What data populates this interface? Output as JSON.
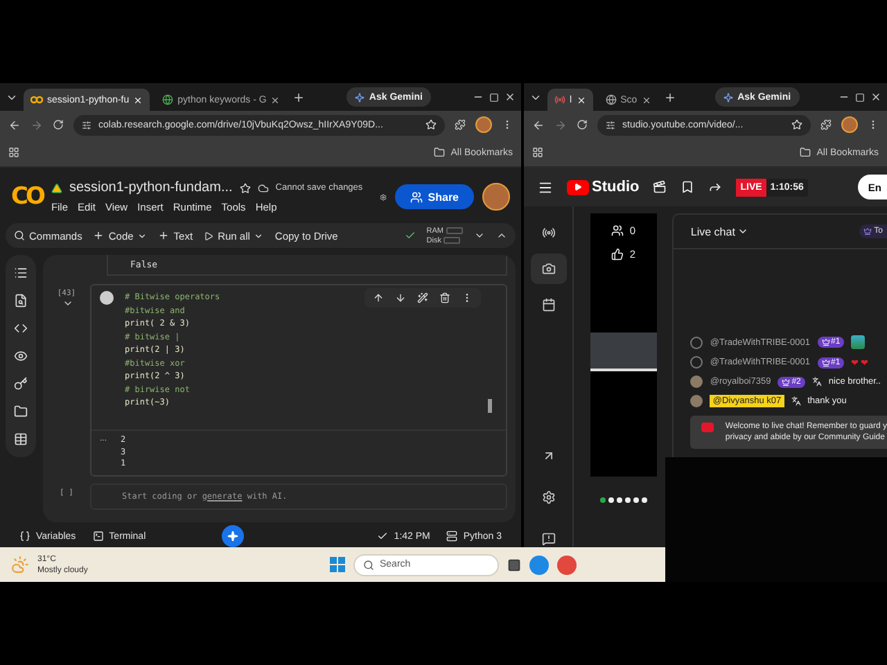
{
  "colab_window": {
    "tabs": [
      {
        "title": "session1-python-fu",
        "selected": true,
        "kind": "colab"
      },
      {
        "title": "python keywords - G",
        "selected": false,
        "kind": "google"
      }
    ],
    "ask_gemini": "Ask Gemini",
    "url": "colab.research.google.com/drive/10jVbuKq2Owsz_hIIrXA9Y09D...",
    "bookmarks_label": "All Bookmarks",
    "logo": "CO",
    "notebook_title": "session1-python-fundam...",
    "save_status": "Cannot save changes",
    "share_label": "Share",
    "menu": [
      "File",
      "Edit",
      "View",
      "Insert",
      "Runtime",
      "Tools",
      "Help"
    ],
    "toolbar": [
      {
        "label": "Commands",
        "kind": "search",
        "dropdown": false
      },
      {
        "label": "Code",
        "kind": "add",
        "dropdown": true
      },
      {
        "label": "Text",
        "kind": "add",
        "dropdown": false
      },
      {
        "label": "Run all",
        "kind": "run",
        "dropdown": true
      },
      {
        "label": "Copy to Drive",
        "kind": "plain",
        "dropdown": false
      }
    ],
    "resources": {
      "ram": "RAM",
      "disk": "Disk"
    },
    "previous_output": "False",
    "cell": {
      "prompt": "[43]",
      "lines": [
        {
          "text": "# Bitwise operators",
          "kind": "comment"
        },
        {
          "text": "#bitwise and",
          "kind": "comment"
        },
        {
          "text": "print( 2 & 3)",
          "kind": "code"
        },
        {
          "text": "# bitwise |",
          "kind": "comment"
        },
        {
          "text": "print(2 | 3)",
          "kind": "code"
        },
        {
          "text": "#bitwise xor",
          "kind": "comment"
        },
        {
          "text": "print(2 ^ 3)",
          "kind": "code"
        },
        {
          "text": "# birwise not",
          "kind": "comment"
        },
        {
          "text": "print(~3)",
          "kind": "code"
        }
      ],
      "output_marker": "...",
      "output": [
        "2",
        "3",
        "1"
      ]
    },
    "empty_cell": {
      "prompt": "[ ]",
      "hint_before": "Start coding or",
      "hint_link": "generate",
      "hint_after": "with AI."
    },
    "status": {
      "variables": "Variables",
      "terminal": "Terminal",
      "time": "1:42 PM",
      "runtime": "Python 3"
    }
  },
  "taskbar": {
    "temperature": "31°C",
    "weather": "Mostly cloudy",
    "search_placeholder": "Search"
  },
  "studio_window": {
    "tabs": [
      {
        "title": "l",
        "selected": true,
        "kind": "record"
      },
      {
        "title": "Sco",
        "selected": false,
        "kind": "globe"
      }
    ],
    "ask_gemini": "Ask Gemini",
    "url": "studio.youtube.com/video/...",
    "bookmarks_label": "All Bookmarks",
    "logo_text": "Studio",
    "live_label": "LIVE",
    "live_time": "1:10:56",
    "header_button": "En",
    "nav_top": [
      {
        "kind": "broadcast",
        "selected": false
      },
      {
        "kind": "camera",
        "selected": true
      },
      {
        "kind": "calendar",
        "selected": false
      }
    ],
    "viewers": "0",
    "likes": "2",
    "carousel": [
      {
        "selected": true
      },
      {
        "selected": false
      },
      {
        "selected": false
      },
      {
        "selected": false
      },
      {
        "selected": false
      },
      {
        "selected": false
      }
    ],
    "chat": {
      "title": "Live chat",
      "filter_badge": "To",
      "messages": [
        {
          "author": "@TradeWithTRIBE-0001",
          "rank": "#1",
          "kind": "sticker",
          "highlighted": false
        },
        {
          "author": "@TradeWithTRIBE-0001",
          "rank": "#1",
          "text": "❤❤",
          "kind": "hearts",
          "highlighted": false
        },
        {
          "author": "@royalboi7359",
          "rank": "#2",
          "text": "nice brother..",
          "kind": "translated",
          "highlighted": false
        },
        {
          "author": "@Divyanshu k07",
          "text": "thank you",
          "kind": "translated",
          "highlighted": true
        }
      ],
      "welcome_lines": [
        "Welcome to live chat! Remember to guard y",
        "privacy and abide by our Community Guide"
      ]
    }
  }
}
